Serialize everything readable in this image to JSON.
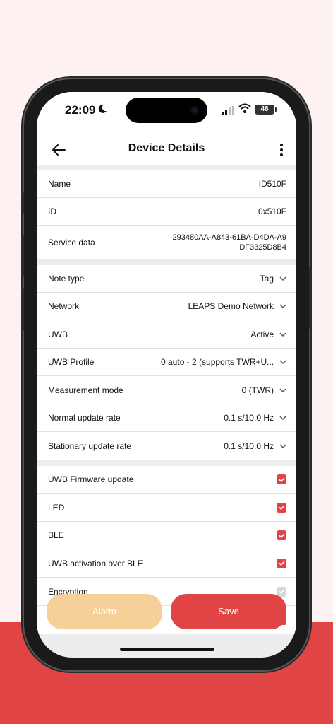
{
  "status_bar": {
    "time": "22:09",
    "battery": "48"
  },
  "appbar": {
    "title": "Device Details"
  },
  "info": [
    {
      "label": "Name",
      "value": "ID510F"
    },
    {
      "label": "ID",
      "value": "0x510F"
    },
    {
      "label": "Service data",
      "value": "293480AA-A843-61BA-D4DA-A9 DF3325D8B4"
    }
  ],
  "settings": [
    {
      "label": "Note type",
      "value": "Tag"
    },
    {
      "label": "Network",
      "value": "LEAPS Demo Network"
    },
    {
      "label": "UWB",
      "value": "Active"
    },
    {
      "label": "UWB Profile",
      "value": "0 auto - 2 (supports TWR+U..."
    },
    {
      "label": "Measurement mode",
      "value": "0 (TWR)"
    },
    {
      "label": "Normal update rate",
      "value": "0.1 s/10.0 Hz"
    },
    {
      "label": "Stationary update rate",
      "value": "0.1 s/10.0 Hz"
    }
  ],
  "toggles": [
    {
      "label": "UWB Firmware update",
      "checked": true
    },
    {
      "label": "LED",
      "checked": true
    },
    {
      "label": "BLE",
      "checked": true
    },
    {
      "label": "UWB activation over BLE",
      "checked": true
    },
    {
      "label": "Encryption",
      "checked": false
    }
  ],
  "buttons": {
    "alarm": "Alarm",
    "save": "Save"
  },
  "colors": {
    "accent": "#e04444",
    "alarm": "#f5d199",
    "background": "#fdf1f1"
  }
}
